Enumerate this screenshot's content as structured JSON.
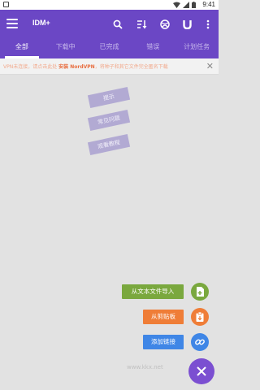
{
  "status_bar": {
    "time": "9:41"
  },
  "app_bar": {
    "title": "IDM+"
  },
  "tabs": [
    {
      "label": "全部"
    },
    {
      "label": "下载中"
    },
    {
      "label": "已完成"
    },
    {
      "label": "错误"
    },
    {
      "label": "计划任务"
    }
  ],
  "notice": {
    "part1": "VPN未连接，请点击此处 ",
    "link": "安装 NordVPN",
    "part2": "，将种子和其它文件完全匿名下载"
  },
  "hints": {
    "tips": "提示",
    "faq": "常见问题",
    "tutorial": "观看教程"
  },
  "fab_menu": {
    "import_text_file": "从文本文件导入",
    "from_clipboard": "从剪贴板",
    "add_link": "添加链接"
  },
  "colors": {
    "primary": "#6b47c5",
    "import_green": "#7aa83e",
    "clipboard_orange": "#ef7d37",
    "link_blue": "#3f86e6",
    "fab_purple": "#7b4fd1"
  },
  "watermark": "www.kkx.net"
}
